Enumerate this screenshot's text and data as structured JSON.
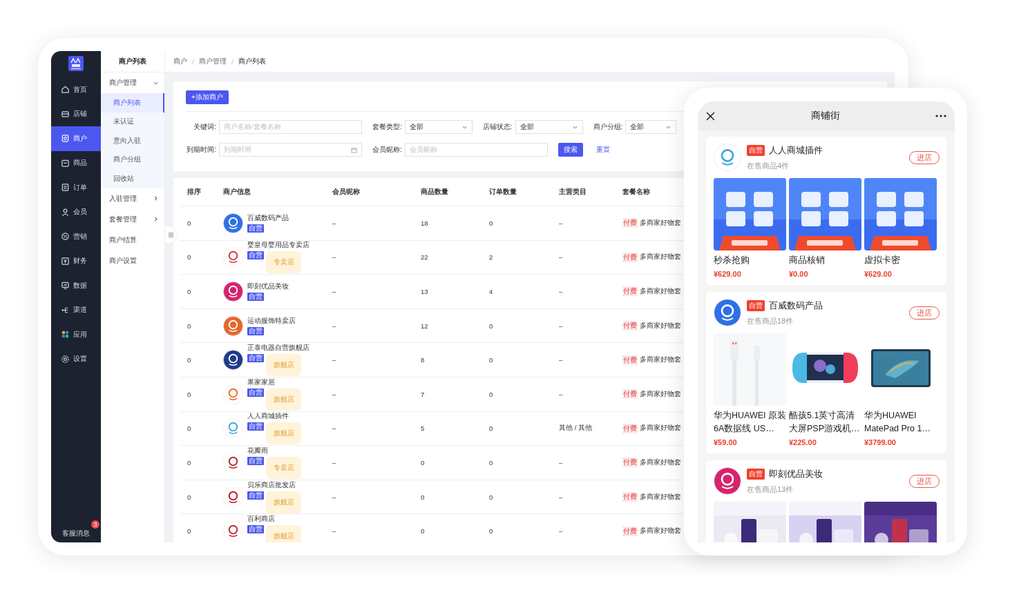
{
  "sidebar": {
    "items": [
      {
        "label": "首页",
        "selected": false
      },
      {
        "label": "店铺",
        "selected": false
      },
      {
        "label": "商户",
        "selected": true
      },
      {
        "label": "商品",
        "selected": false
      },
      {
        "label": "订单",
        "selected": false
      },
      {
        "label": "会员",
        "selected": false
      },
      {
        "label": "营销",
        "selected": false
      },
      {
        "label": "财务",
        "selected": false
      },
      {
        "label": "数据",
        "selected": false
      },
      {
        "label": "渠道",
        "selected": false
      },
      {
        "label": "应用",
        "selected": false
      },
      {
        "label": "设置",
        "selected": false
      }
    ],
    "footer": {
      "label": "客服消息",
      "badge": "3"
    }
  },
  "submenu": {
    "title": "商户列表",
    "items": [
      {
        "label": "商户管理",
        "kind": "group",
        "expanded": true,
        "children": [
          {
            "label": "商户列表",
            "selected": true
          },
          {
            "label": "未认证",
            "selected": false
          },
          {
            "label": "意向入驻",
            "selected": false
          },
          {
            "label": "商户分组",
            "selected": false
          },
          {
            "label": "回收站",
            "selected": false
          }
        ]
      },
      {
        "label": "入驻管理",
        "kind": "group",
        "expanded": false
      },
      {
        "label": "套餐管理",
        "kind": "group",
        "expanded": false
      },
      {
        "label": "商户结算",
        "kind": "link"
      },
      {
        "label": "商户设置",
        "kind": "link"
      }
    ]
  },
  "breadcrumb": [
    "商户",
    "商户管理",
    "商户列表"
  ],
  "add_button": "+添加商户",
  "filters": [
    [
      {
        "label": "关键词:",
        "kind": "text",
        "placeholder": "商户名称/套餐名称"
      },
      {
        "label": "套餐类型:",
        "kind": "select",
        "value": "全部"
      },
      {
        "label": "店铺状态:",
        "kind": "select",
        "value": "全部"
      },
      {
        "label": "商户分组:",
        "kind": "select",
        "value": "全部"
      }
    ],
    [
      {
        "label": "到期时间:",
        "kind": "date",
        "placeholder": "到期时间"
      },
      {
        "label": "会员昵称:",
        "kind": "text",
        "placeholder": "会员昵称"
      }
    ]
  ],
  "search_button": "搜索",
  "reset_link": "重置",
  "table": {
    "columns": [
      "排序",
      "商户信息",
      "会员昵称",
      "商品数量",
      "订单数量",
      "主营类目",
      "套餐名称"
    ],
    "rows": [
      {
        "rank": "0",
        "name": "百威数码产品",
        "tags": [
          {
            "label": "自营",
            "kind": "self"
          }
        ],
        "nickname": "–",
        "products": "18",
        "orders": "0",
        "category": "–",
        "plan_tag": "付费",
        "plan": "多商家好物套"
      },
      {
        "rank": "0",
        "name": "婴皇母婴用品专卖店",
        "tags": [
          {
            "label": "自营",
            "kind": "self"
          },
          {
            "label": "专卖店",
            "kind": "shop"
          }
        ],
        "nickname": "–",
        "products": "22",
        "orders": "2",
        "category": "–",
        "plan_tag": "付费",
        "plan": "多商家好物套"
      },
      {
        "rank": "0",
        "name": "即刻优品美妆",
        "tags": [
          {
            "label": "自营",
            "kind": "self"
          }
        ],
        "nickname": "–",
        "products": "13",
        "orders": "4",
        "category": "–",
        "plan_tag": "付费",
        "plan": "多商家好物套"
      },
      {
        "rank": "0",
        "name": "运动服饰特卖店",
        "tags": [
          {
            "label": "自营",
            "kind": "self"
          }
        ],
        "nickname": "–",
        "products": "12",
        "orders": "0",
        "category": "–",
        "plan_tag": "付费",
        "plan": "多商家好物套"
      },
      {
        "rank": "0",
        "name": "正泰电器自营旗舰店",
        "tags": [
          {
            "label": "自营",
            "kind": "self"
          },
          {
            "label": "旗舰店",
            "kind": "shop"
          }
        ],
        "nickname": "–",
        "products": "8",
        "orders": "0",
        "category": "–",
        "plan_tag": "付费",
        "plan": "多商家好物套"
      },
      {
        "rank": "0",
        "name": "果家家居",
        "tags": [
          {
            "label": "自营",
            "kind": "self"
          },
          {
            "label": "旗舰店",
            "kind": "shop"
          }
        ],
        "nickname": "–",
        "products": "7",
        "orders": "0",
        "category": "–",
        "plan_tag": "付费",
        "plan": "多商家好物套"
      },
      {
        "rank": "0",
        "name": "人人商城插件",
        "tags": [
          {
            "label": "自营",
            "kind": "self"
          },
          {
            "label": "旗舰店",
            "kind": "shop"
          }
        ],
        "nickname": "–",
        "products": "5",
        "orders": "0",
        "category": "其他 / 其他",
        "plan_tag": "付费",
        "plan": "多商家好物套"
      },
      {
        "rank": "0",
        "name": "花瓣雨",
        "tags": [
          {
            "label": "自营",
            "kind": "self"
          },
          {
            "label": "专卖店",
            "kind": "shop"
          }
        ],
        "nickname": "–",
        "products": "0",
        "orders": "0",
        "category": "–",
        "plan_tag": "付费",
        "plan": "多商家好物套"
      },
      {
        "rank": "0",
        "name": "贝乐商店批发店",
        "tags": [
          {
            "label": "自营",
            "kind": "self"
          },
          {
            "label": "旗舰店",
            "kind": "shop"
          }
        ],
        "nickname": "–",
        "products": "0",
        "orders": "0",
        "category": "–",
        "plan_tag": "付费",
        "plan": "多商家好物套"
      },
      {
        "rank": "0",
        "name": "百利商店",
        "tags": [
          {
            "label": "自营",
            "kind": "self"
          },
          {
            "label": "旗舰店",
            "kind": "shop"
          }
        ],
        "nickname": "–",
        "products": "0",
        "orders": "0",
        "category": "–",
        "plan_tag": "付费",
        "plan": "多商家好物套"
      }
    ]
  },
  "phone": {
    "title": "商铺街",
    "shops": [
      {
        "tag": "自营",
        "name": "人人商城插件",
        "count": "在售商品4件",
        "enter": "进店",
        "products": [
          {
            "kind": "picture",
            "name": "秒杀抢购",
            "price": "¥629.00"
          },
          {
            "kind": "picture",
            "name": "商品核销",
            "price": "¥0.00"
          },
          {
            "kind": "picture",
            "name": "虚拟卡密",
            "price": "¥629.00"
          }
        ]
      },
      {
        "tag": "自营",
        "name": "百威数码产品",
        "count": "在售商品18件",
        "enter": "进店",
        "products": [
          {
            "kind": "picture",
            "name": "华为HUAWEI 原装6A数据线 US…",
            "price": "¥59.00"
          },
          {
            "kind": "picture",
            "name": "酷孩5.1英寸高清大屏PSP游戏机…",
            "price": "¥225.00"
          },
          {
            "kind": "picture",
            "name": "华为HUAWEI MatePad Pro 1…",
            "price": "¥3799.00"
          }
        ]
      },
      {
        "tag": "自营",
        "name": "即刻优品美妆",
        "count": "在售商品13件",
        "enter": "进店"
      }
    ]
  }
}
